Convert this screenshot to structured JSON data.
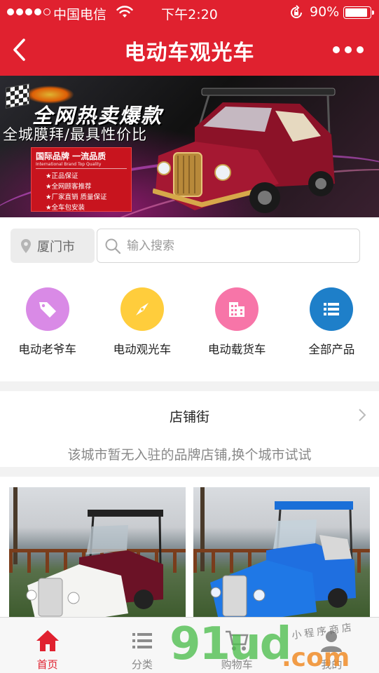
{
  "status_bar": {
    "carrier": "中国电信",
    "time": "下午2:20",
    "battery": "90%",
    "battery_level": 0.9
  },
  "nav": {
    "title": "电动车观光车",
    "back_icon": "chevron-left-icon",
    "more_icon": "more-dots-icon"
  },
  "banner": {
    "headline": "全网热卖爆款",
    "subline": "全城膜拜/最具性价比",
    "box_title": "国际品牌 一流品质",
    "box_subtitle": "International Brand  Top Quality",
    "box_items": [
      "★正品保证",
      "★全网顾客推荐",
      "★厂家直销 质量保证",
      "★全车包安装"
    ]
  },
  "search": {
    "city": "厦门市",
    "placeholder": "输入搜索"
  },
  "categories": [
    {
      "label": "电动老爷车",
      "icon": "tag-icon",
      "color": "#d98ae6"
    },
    {
      "label": "电动观光车",
      "icon": "compass-icon",
      "color": "#ffcd3c"
    },
    {
      "label": "电动载货车",
      "icon": "building-icon",
      "color": "#f775a8"
    },
    {
      "label": "全部产品",
      "icon": "list-icon",
      "color": "#1e7fc9"
    }
  ],
  "shop_street": {
    "title": "店铺街",
    "empty_message": "该城市暂无入驻的品牌店铺,换个城市试试"
  },
  "tabbar": [
    {
      "label": "首页",
      "icon": "home-icon",
      "active": true
    },
    {
      "label": "分类",
      "icon": "list-icon",
      "active": false
    },
    {
      "label": "购物车",
      "icon": "cart-icon",
      "active": false
    },
    {
      "label": "我的",
      "icon": "user-icon",
      "active": false
    }
  ],
  "watermark": {
    "brand": "91ud",
    "suffix": ".com",
    "tagline": "小程序商店"
  },
  "colors": {
    "accent": "#e0212f",
    "background": "#f2f2f2"
  }
}
